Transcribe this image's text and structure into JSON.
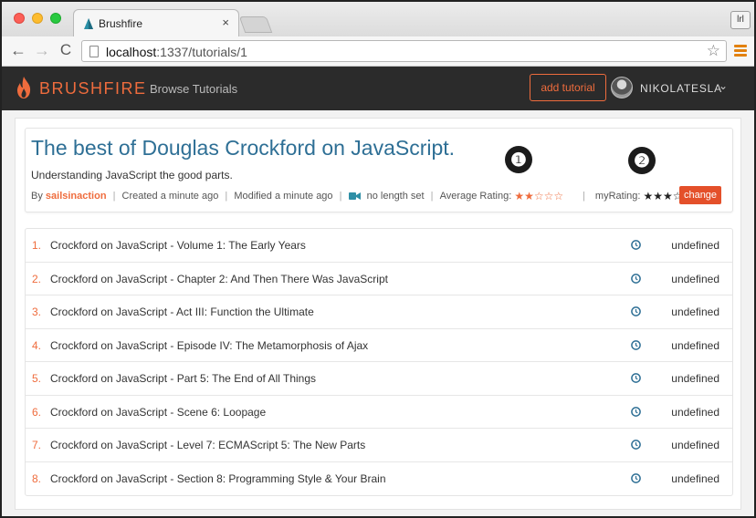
{
  "browser": {
    "tab_title": "Brushfire",
    "tab_close": "×",
    "profile_label": "lrl",
    "url_host": "localhost",
    "url_path": ":1337/tutorials/1",
    "back_glyph": "←",
    "forward_glyph": "→",
    "reload_glyph": "C",
    "star_glyph": "☆"
  },
  "navbar": {
    "brand": "BRUSHFIRE",
    "browse_link": "Browse Tutorials",
    "add_tutorial": "add tutorial",
    "username": "NIKOLATESLA",
    "caret": "⌄"
  },
  "tutorial": {
    "title": "The best of Douglas Crockford on JavaScript.",
    "description": "Understanding JavaScript the good parts.",
    "by_label": "By",
    "owner": "sailsinaction",
    "created": "Created a minute ago",
    "modified": "Modified a minute ago",
    "length": "no length set",
    "avg_rating_label": "Average Rating:",
    "avg_stars": "★★☆☆☆",
    "my_rating_label": "myRating:",
    "my_stars": "★★★☆☆",
    "change_button": "change",
    "separator": "|"
  },
  "callouts": [
    "❶",
    "❷"
  ],
  "videos": [
    {
      "number": "1.",
      "title": "Crockford on JavaScript - Volume 1: The Early Years",
      "length": "undefined"
    },
    {
      "number": "2.",
      "title": "Crockford on JavaScript - Chapter 2: And Then There Was JavaScript",
      "length": "undefined"
    },
    {
      "number": "3.",
      "title": "Crockford on JavaScript - Act III: Function the Ultimate",
      "length": "undefined"
    },
    {
      "number": "4.",
      "title": "Crockford on JavaScript - Episode IV: The Metamorphosis of Ajax",
      "length": "undefined"
    },
    {
      "number": "5.",
      "title": "Crockford on JavaScript - Part 5: The End of All Things",
      "length": "undefined"
    },
    {
      "number": "6.",
      "title": "Crockford on JavaScript - Scene 6: Loopage",
      "length": "undefined"
    },
    {
      "number": "7.",
      "title": "Crockford on JavaScript - Level 7: ECMAScript 5: The New Parts",
      "length": "undefined"
    },
    {
      "number": "8.",
      "title": "Crockford on JavaScript - Section 8: Programming Style & Your Brain",
      "length": "undefined"
    }
  ],
  "colors": {
    "accent": "#ef6c3d",
    "title_blue": "#2e6f95",
    "navbar_bg": "#2b2b2b",
    "change_btn": "#e4502a"
  }
}
